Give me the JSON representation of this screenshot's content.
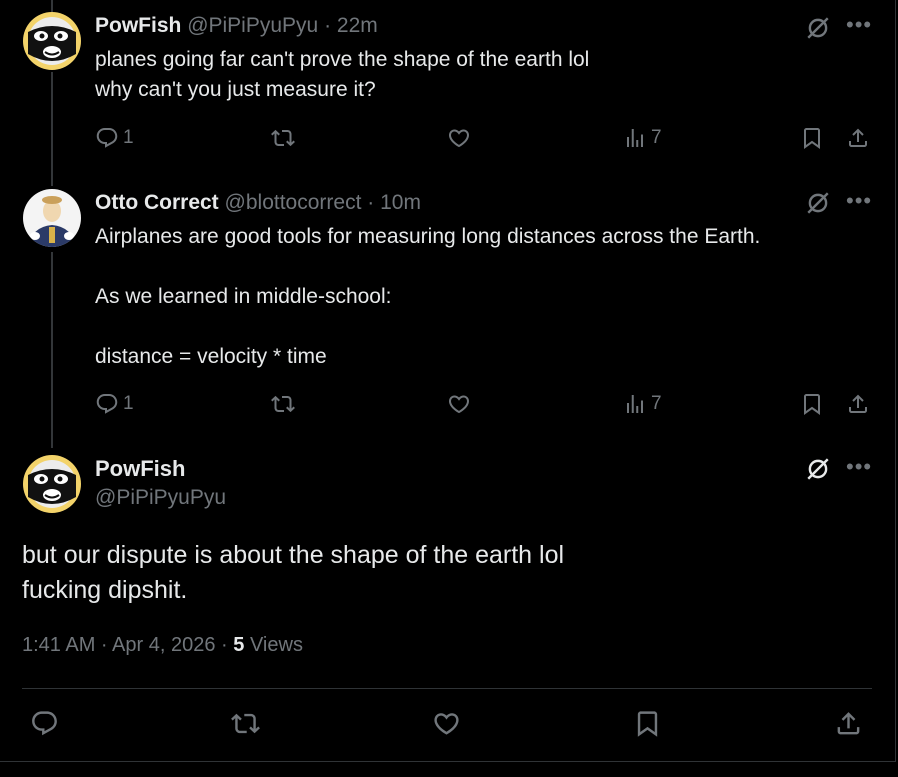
{
  "replies": [
    {
      "name": "PowFish",
      "handle": "@PiPiPyuPyu",
      "time": "22m",
      "lines": [
        "planes going far can't prove the shape of the earth lol",
        "why can't you just measure it?"
      ],
      "reply_count": "1",
      "retweet_count": "",
      "like_count": "",
      "view_count": "7"
    },
    {
      "name": "Otto Correct",
      "handle": "@blottocorrect",
      "time": "10m",
      "lines": [
        "Airplanes are good tools for measuring long distances across the Earth.",
        "",
        "As we learned in middle-school:",
        "",
        "distance = velocity * time"
      ],
      "reply_count": "1",
      "retweet_count": "",
      "like_count": "",
      "view_count": "7"
    }
  ],
  "main_post": {
    "name": "PowFish",
    "handle": "@PiPiPyuPyu",
    "lines": [
      "but our dispute is about the shape of the earth lol",
      "fucking dipshit."
    ],
    "timestamp": "1:41 AM · Apr 4, 2026",
    "views_count": "5",
    "views_label": "Views"
  },
  "separator": "·",
  "icons": {
    "reply": "reply-icon",
    "retweet": "retweet-icon",
    "like": "like-icon",
    "views": "views-icon",
    "bookmark": "bookmark-icon",
    "share": "share-icon",
    "grok": "grok-icon",
    "more": "more-icon"
  },
  "colors": {
    "background": "#000000",
    "text": "#e7e9ea",
    "muted": "#71767b",
    "border": "#2f3336"
  }
}
